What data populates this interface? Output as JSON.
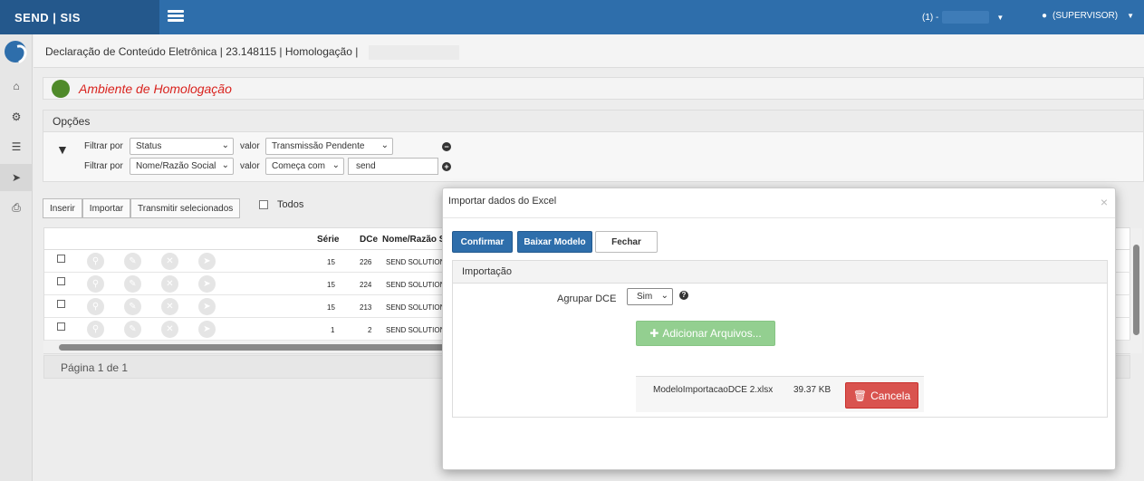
{
  "app": {
    "brand": "SEND | SIS"
  },
  "topbar": {
    "company": "(1) -",
    "user": "(SUPERVISOR)"
  },
  "sidebar": {
    "items": [
      {
        "icon": "home-icon",
        "glyph": "⌂"
      },
      {
        "icon": "cogs-icon",
        "glyph": "⚙"
      },
      {
        "icon": "list-icon",
        "glyph": "☰"
      },
      {
        "icon": "paper-plane-icon",
        "glyph": "➤"
      },
      {
        "icon": "print-icon",
        "glyph": "⎙"
      }
    ]
  },
  "breadcrumb": "Declaração de Conteúdo Eletrônica | 23.148115 | Homologação |",
  "environment": {
    "label": "Ambiente de Homologação",
    "dot_color": "#4f8a2a",
    "text_color": "#d9231e"
  },
  "options": {
    "title": "Opções",
    "filters": [
      {
        "filter_label": "Filtrar por",
        "field": "Status",
        "value_label": "valor",
        "value": "Transmissão Pendente",
        "action": "−"
      },
      {
        "filter_label": "Filtrar por",
        "field": "Nome/Razão Social",
        "value_label": "valor",
        "operator": "Começa com",
        "text": "send",
        "action": "+"
      }
    ]
  },
  "toolbar": {
    "insert": "Inserir",
    "import": "Importar",
    "transmit": "Transmitir selecionados",
    "all": "Todos"
  },
  "grid": {
    "headers": {
      "serie": "Série",
      "dce": "DCe",
      "name": "Nome/Razão S"
    },
    "rows": [
      {
        "serie": "15",
        "dce": "226",
        "name": "SEND SOLUTIONS"
      },
      {
        "serie": "15",
        "dce": "224",
        "name": "SEND SOLUTIONS"
      },
      {
        "serie": "15",
        "dce": "213",
        "name": "SEND SOLUTIONS"
      },
      {
        "serie": "1",
        "dce": "2",
        "name": "SEND SOLUTIONS"
      }
    ],
    "pager": "Página 1 de 1"
  },
  "modal": {
    "title": "Importar dados do Excel",
    "close": "×",
    "confirm": "Confirmar",
    "download": "Baixar Modelo",
    "closeBtn": "Fechar",
    "panel_title": "Importação",
    "group_label": "Agrupar DCE",
    "group_value": "Sim",
    "add_files": "Adicionar Arquivos...",
    "file": {
      "name": "ModeloImportacaoDCE 2.xlsx",
      "size": "39.37 KB",
      "cancel": "Cancela"
    }
  },
  "colors": {
    "primary": "#2e6eab",
    "success": "#93cf90",
    "danger": "#d9534f"
  }
}
